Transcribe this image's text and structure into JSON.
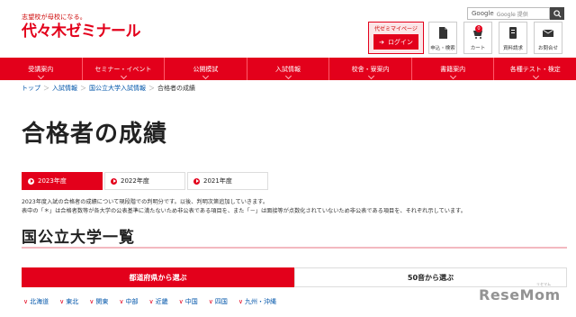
{
  "header": {
    "tagline": "志望校が母校になる。",
    "logo": "代々木ゼミナール",
    "search_placeholder": "Google 提供",
    "mypage_label": "代ゼミマイページ",
    "login_label": "ログイン",
    "icons": [
      {
        "label": "申込・検索",
        "icon": "document-icon"
      },
      {
        "label": "カート",
        "icon": "cart-icon",
        "badge": "0"
      },
      {
        "label": "資料請求",
        "icon": "book-icon"
      },
      {
        "label": "お問合せ",
        "icon": "mail-icon"
      }
    ]
  },
  "nav": {
    "items": [
      {
        "label": "受講案内"
      },
      {
        "label": "セミナー・イベント"
      },
      {
        "label": "公開模試"
      },
      {
        "label": "入試情報"
      },
      {
        "label": "校舎・寮案内"
      },
      {
        "label": "書籍案内"
      },
      {
        "label": "各種テスト・検定"
      }
    ]
  },
  "breadcrumb": {
    "items": [
      "トップ",
      "入試情報",
      "国公立大学入試情報",
      "合格者の成績"
    ],
    "separator": "＞"
  },
  "page": {
    "title": "合格者の成績",
    "year_tabs": [
      {
        "label": "2023年度",
        "active": true
      },
      {
        "label": "2022年度",
        "active": false
      },
      {
        "label": "2021年度",
        "active": false
      }
    ],
    "notes": [
      "2023年度入試の合格者の成績について現段階での判明分です。以後、判明次第追加していきます。",
      "表中の「＊」は合格者数等が各大学の公表基準に満たないため非公表である項目を、また「－」は面接等が点数化されていないため非公表である項目を、それぞれ示しています。"
    ],
    "section_title": "国公立大学一覧",
    "select_tabs": [
      {
        "label": "都道府県から選ぶ",
        "active": true
      },
      {
        "label": "50音から選ぶ",
        "active": false
      }
    ],
    "regions": [
      "北海道",
      "東北",
      "関東",
      "中部",
      "近畿",
      "中国",
      "四国",
      "九州・沖縄"
    ]
  },
  "watermark": {
    "text": "ReseMom",
    "sub": "リセマム"
  },
  "colors": {
    "brand_red": "#e3001b",
    "link_blue": "#0055aa"
  }
}
